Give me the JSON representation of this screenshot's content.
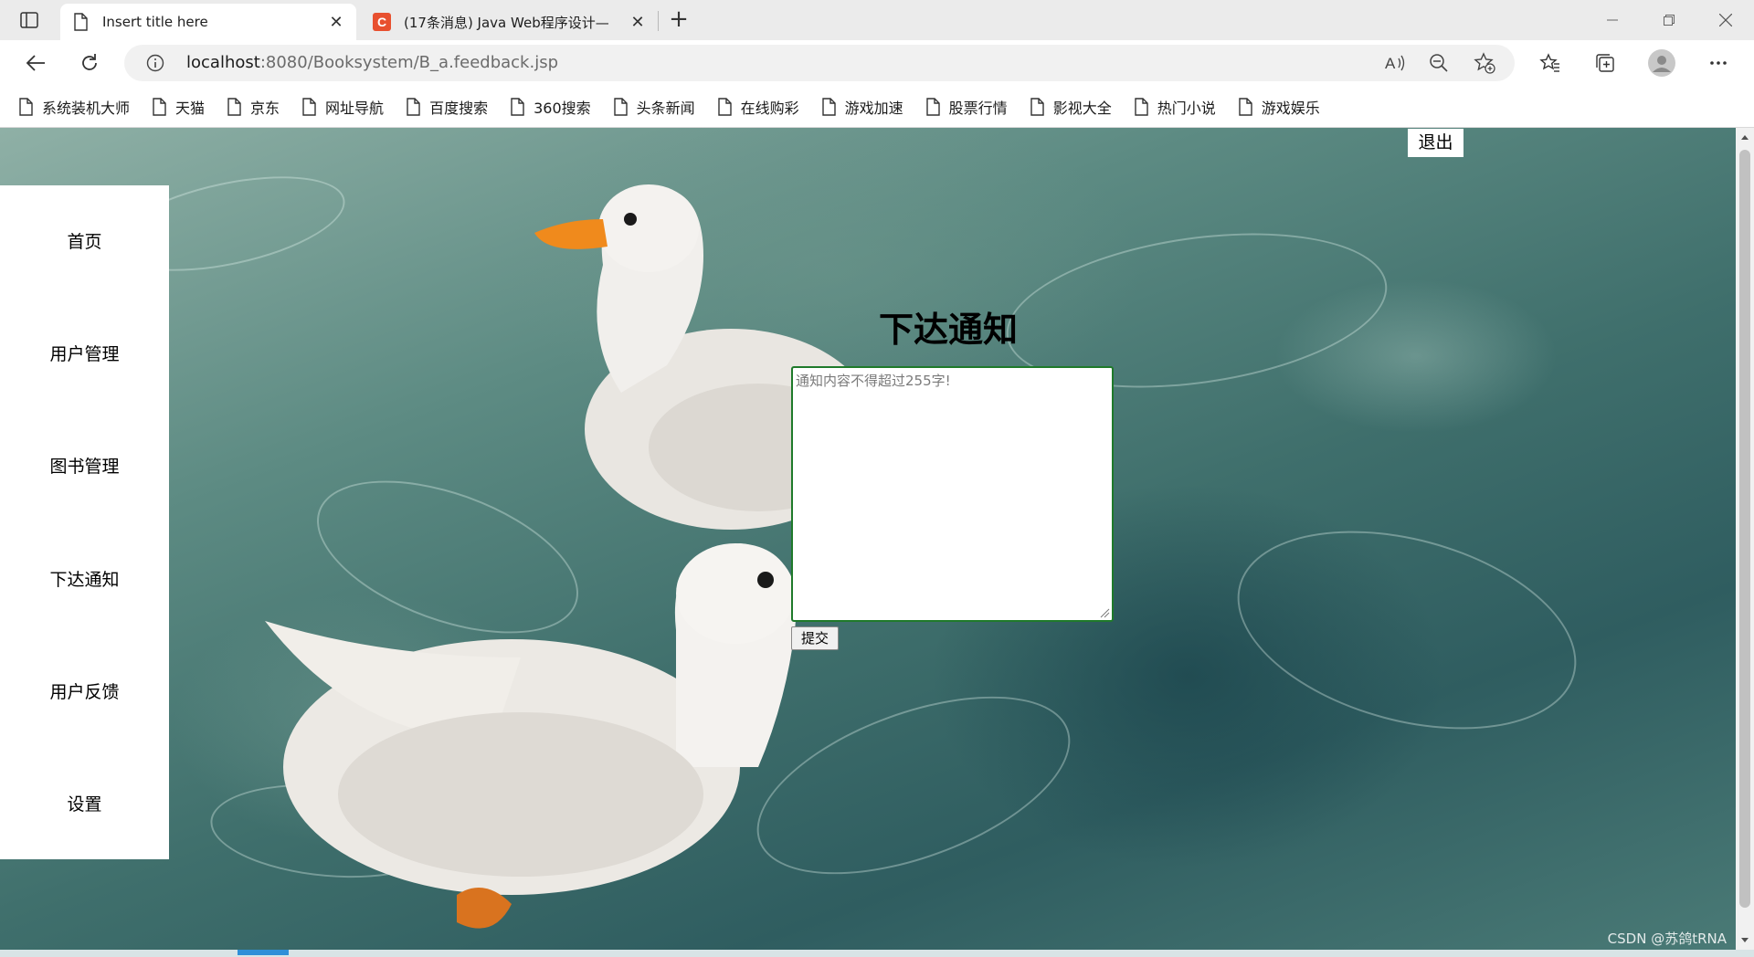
{
  "browser": {
    "tabs": [
      {
        "title": "Insert title here"
      },
      {
        "title": "(17条消息) Java Web程序设计—",
        "favicon_letter": "C",
        "favicon_color": "#e8502f"
      }
    ],
    "new_tab": "+",
    "url_host": "localhost",
    "url_rest": ":8080/Booksystem/B_a.feedback.jsp"
  },
  "bookmarks": [
    "系统装机大师",
    "天猫",
    "京东",
    "网址导航",
    "百度搜索",
    "360搜索",
    "头条新闻",
    "在线购彩",
    "游戏加速",
    "股票行情",
    "影视大全",
    "热门小说",
    "游戏娱乐"
  ],
  "sidebar": {
    "items": [
      {
        "label": "首页"
      },
      {
        "label": "用户管理"
      },
      {
        "label": "图书管理"
      },
      {
        "label": "下达通知"
      },
      {
        "label": "用户反馈"
      },
      {
        "label": "设置"
      }
    ]
  },
  "header": {
    "logout": "退出"
  },
  "main": {
    "title": "下达通知",
    "textarea_placeholder": "通知内容不得超过255字!",
    "submit_label": "提交"
  },
  "watermark": "CSDN @苏鸽tRNA",
  "colors": {
    "textarea_border": "#1f7a2a",
    "csdn_favicon": "#e8502f",
    "scrollbar_accent": "#2f8fd8"
  }
}
